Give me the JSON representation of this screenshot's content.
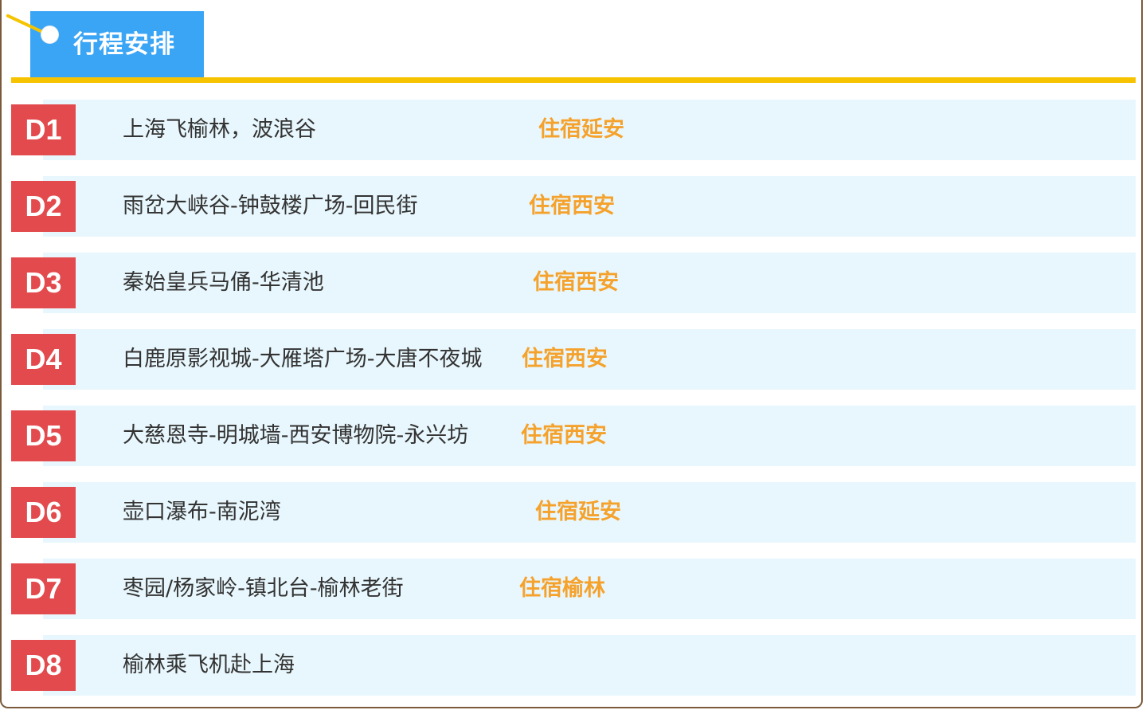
{
  "header": {
    "title": "行程安排"
  },
  "days": [
    {
      "label": "D1",
      "route": "上海飞榆林，波浪谷",
      "stay": "住宿延安"
    },
    {
      "label": "D2",
      "route": "雨岔大峡谷-钟鼓楼广场-回民街",
      "stay": "住宿西安"
    },
    {
      "label": "D3",
      "route": "秦始皇兵马俑-华清池",
      "stay": "住宿西安"
    },
    {
      "label": "D4",
      "route": "白鹿原影视城-大雁塔广场-大唐不夜城",
      "stay": "住宿西安"
    },
    {
      "label": "D5",
      "route": "大慈恩寺-明城墙-西安博物院-永兴坊",
      "stay": "住宿西安"
    },
    {
      "label": "D6",
      "route": "壶口瀑布-南泥湾",
      "stay": "住宿延安"
    },
    {
      "label": "D7",
      "route": "枣园/杨家岭-镇北台-榆林老街",
      "stay": "住宿榆林"
    },
    {
      "label": "D8",
      "route": "榆林乘飞机赴上海",
      "stay": ""
    }
  ],
  "colors": {
    "header_tab": "#3aa5f5",
    "divider": "#f7c300",
    "badge": "#e24a4d",
    "row_bg": "#e8f7fd",
    "stay_text": "#f5a22d",
    "frame": "#7b5a3c"
  }
}
